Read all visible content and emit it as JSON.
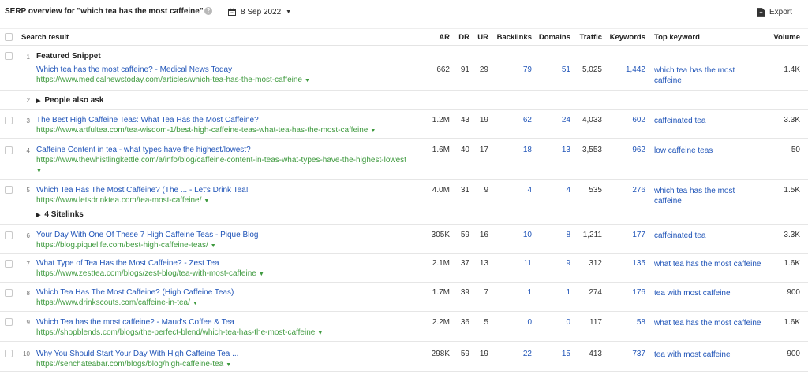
{
  "header": {
    "title": "SERP overview for \"which tea has the most caffeine\"",
    "help_glyph": "?",
    "date": "8 Sep 2022",
    "export_label": "Export"
  },
  "columns": {
    "search_result": "Search result",
    "ar": "AR",
    "dr": "DR",
    "ur": "UR",
    "backlinks": "Backlinks",
    "domains": "Domains",
    "traffic": "Traffic",
    "keywords": "Keywords",
    "top_keyword": "Top keyword",
    "volume": "Volume"
  },
  "rows": [
    {
      "position": "1",
      "feature_label": "Featured Snippet",
      "title": "Which tea has the most caffeine? - Medical News Today",
      "url": "https://www.medicalnewstoday.com/articles/which-tea-has-the-most-caffeine",
      "ar": "662",
      "dr": "91",
      "ur": "29",
      "backlinks": "79",
      "domains": "51",
      "traffic": "5,025",
      "keywords": "1,442",
      "top_keyword_line1": "which tea has the most",
      "top_keyword_line2": "caffeine",
      "volume": "1.4K"
    },
    {
      "position": "2",
      "label": "People also ask"
    },
    {
      "position": "3",
      "title": "The Best High Caffeine Teas: What Tea Has the Most Caffeine?",
      "url": "https://www.artfultea.com/tea-wisdom-1/best-high-caffeine-teas-what-tea-has-the-most-caffeine",
      "ar": "1.2M",
      "dr": "43",
      "ur": "19",
      "backlinks": "62",
      "domains": "24",
      "traffic": "4,033",
      "keywords": "602",
      "top_keyword_line1": "caffeinated tea",
      "top_keyword_line2": "",
      "volume": "3.3K"
    },
    {
      "position": "4",
      "title": "Caffeine Content in tea - what types have the highest/lowest?",
      "url": "https://www.thewhistlingkettle.com/a/info/blog/caffeine-content-in-teas-what-types-have-the-highest-lowest",
      "ar": "1.6M",
      "dr": "40",
      "ur": "17",
      "backlinks": "18",
      "domains": "13",
      "traffic": "3,553",
      "keywords": "962",
      "top_keyword_line1": "low caffeine teas",
      "top_keyword_line2": "",
      "volume": "50"
    },
    {
      "position": "5",
      "title": "Which Tea Has The Most Caffeine? (The ... - Let's Drink Tea!",
      "url": "https://www.letsdrinktea.com/tea-most-caffeine/",
      "ar": "4.0M",
      "dr": "31",
      "ur": "9",
      "backlinks": "4",
      "domains": "4",
      "traffic": "535",
      "keywords": "276",
      "top_keyword_line1": "which tea has the most",
      "top_keyword_line2": "caffeine",
      "volume": "1.5K",
      "sitelinks_label": "4 Sitelinks"
    },
    {
      "position": "6",
      "title": "Your Day With One Of These 7 High Caffeine Teas - Pique Blog",
      "url": "https://blog.piquelife.com/best-high-caffeine-teas/",
      "ar": "305K",
      "dr": "59",
      "ur": "16",
      "backlinks": "10",
      "domains": "8",
      "traffic": "1,211",
      "keywords": "177",
      "top_keyword_line1": "caffeinated tea",
      "top_keyword_line2": "",
      "volume": "3.3K"
    },
    {
      "position": "7",
      "title": "What Type of Tea Has the Most Caffeine? - Zest Tea",
      "url": "https://www.zesttea.com/blogs/zest-blog/tea-with-most-caffeine",
      "ar": "2.1M",
      "dr": "37",
      "ur": "13",
      "backlinks": "11",
      "domains": "9",
      "traffic": "312",
      "keywords": "135",
      "top_keyword_line1": "what tea has the most caffeine",
      "top_keyword_line2": "",
      "volume": "1.6K"
    },
    {
      "position": "8",
      "title": "Which Tea Has The Most Caffeine? (High Caffeine Teas)",
      "url": "https://www.drinkscouts.com/caffeine-in-tea/",
      "ar": "1.7M",
      "dr": "39",
      "ur": "7",
      "backlinks": "1",
      "domains": "1",
      "traffic": "274",
      "keywords": "176",
      "top_keyword_line1": "tea with most caffeine",
      "top_keyword_line2": "",
      "volume": "900"
    },
    {
      "position": "9",
      "title": "Which Tea has the most caffeine? - Maud's Coffee & Tea",
      "url": "https://shopblends.com/blogs/the-perfect-blend/which-tea-has-the-most-caffeine",
      "ar": "2.2M",
      "dr": "36",
      "ur": "5",
      "backlinks": "0",
      "domains": "0",
      "traffic": "117",
      "keywords": "58",
      "top_keyword_line1": "what tea has the most caffeine",
      "top_keyword_line2": "",
      "volume": "1.6K"
    },
    {
      "position": "10",
      "title": "Why You Should Start Your Day With High Caffeine Tea ...",
      "url": "https://senchateabar.com/blogs/blog/high-caffeine-tea",
      "ar": "298K",
      "dr": "59",
      "ur": "19",
      "backlinks": "22",
      "domains": "15",
      "traffic": "413",
      "keywords": "737",
      "top_keyword_line1": "tea with most caffeine",
      "top_keyword_line2": "",
      "volume": "900"
    }
  ]
}
